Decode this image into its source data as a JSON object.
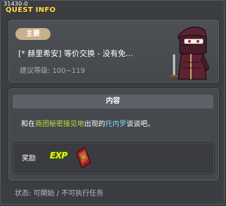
{
  "window": {
    "quest_id": "31430-0",
    "title": "QUEST INFO"
  },
  "quest": {
    "category_badge": "主要",
    "name": "[* 赫里希安] 等价交换 - 没有免...",
    "level_requirement": "建议等级: 100~119"
  },
  "content": {
    "header": "内容",
    "description": {
      "part1": "和在",
      "place": "商团秘密接见地",
      "part2": "出现的",
      "npc": "托内罗",
      "part3": "谈谈吧。"
    }
  },
  "rewards": {
    "label": "奖励",
    "exp_icon_text": "EXP",
    "items": [
      "exp-icon",
      "scroll-icon"
    ]
  },
  "status": {
    "text": "状态: 可開始 / 不可执行任务"
  },
  "colors": {
    "title": "#ffe15a",
    "highlight_place": "#b6e53b",
    "highlight_npc": "#7fd9ff",
    "badge": "#c8b08c"
  }
}
